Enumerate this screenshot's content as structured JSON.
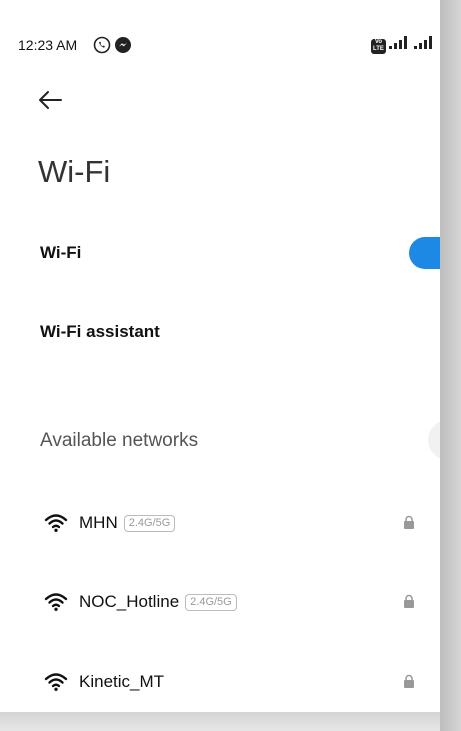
{
  "status_bar": {
    "time": "12:23 AM",
    "icons": [
      "viber-icon",
      "messenger-icon",
      "volte-icon",
      "signal-icon",
      "signal-icon"
    ],
    "volte_label": "Vo LTE"
  },
  "header": {
    "title": "Wi-Fi"
  },
  "settings": {
    "wifi_label": "Wi-Fi",
    "wifi_enabled": true,
    "assistant_label": "Wi-Fi assistant"
  },
  "networks": {
    "section_title": "Available networks",
    "items": [
      {
        "name": "MHN",
        "band": "2.4G/5G",
        "secured": true
      },
      {
        "name": "NOC_Hotline",
        "band": "2.4G/5G",
        "secured": true
      },
      {
        "name": "Kinetic_MT",
        "band": "",
        "secured": true
      }
    ]
  },
  "colors": {
    "toggle_on": "#1e88e5",
    "text_primary": "#111111",
    "text_secondary": "#555555"
  }
}
